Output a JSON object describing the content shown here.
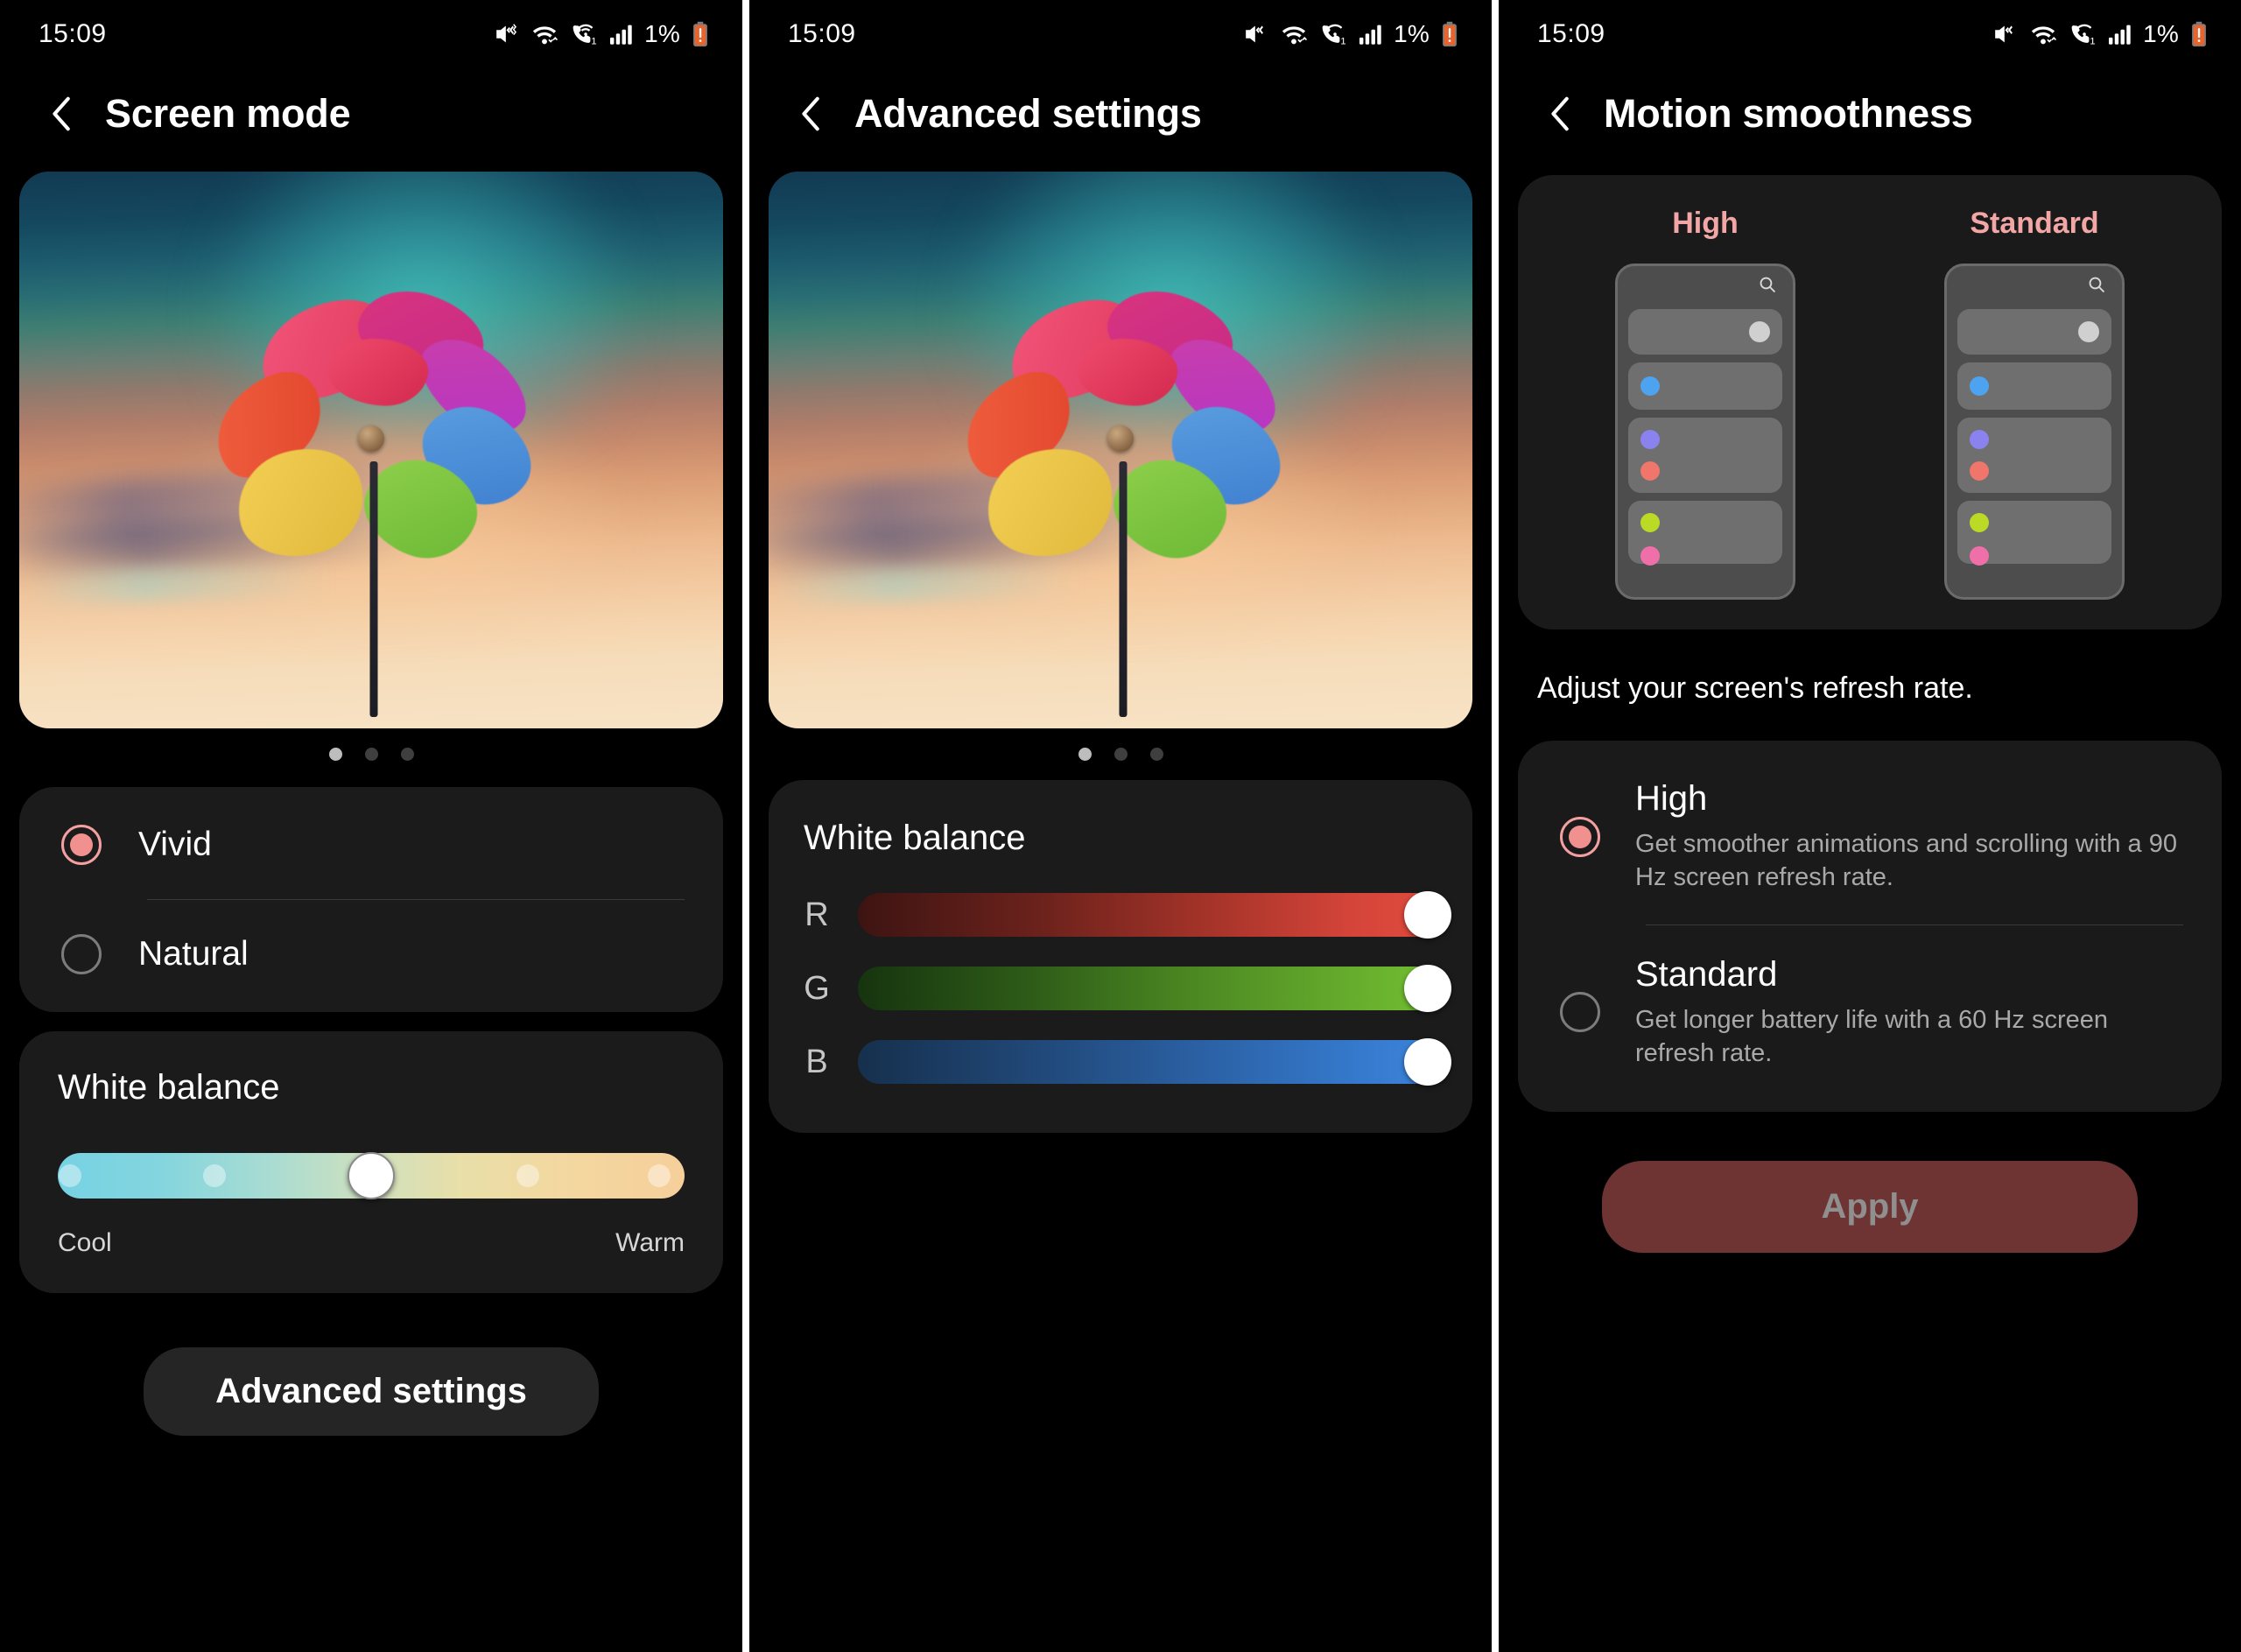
{
  "status_bar": {
    "time": "15:09",
    "battery_percent": "1%",
    "icons": [
      "mute-vibrate-icon",
      "wifi-icon",
      "wifi-calling-icon",
      "signal-bars-icon",
      "battery-low-icon"
    ]
  },
  "colors": {
    "accent_pink": "#f0918f",
    "screen_bg": "#000000",
    "card_bg": "#1b1b1b",
    "apply_disabled_bg": "#6e3434",
    "apply_disabled_text": "#8f8f8f",
    "preview_title": "#f2a6a6"
  },
  "panel1": {
    "title": "Screen mode",
    "back_icon": "chevron-left-icon",
    "pager": {
      "count": 3,
      "active_index": 0
    },
    "modes": [
      {
        "label": "Vivid",
        "selected": true
      },
      {
        "label": "Natural",
        "selected": false
      }
    ],
    "white_balance": {
      "title": "White balance",
      "left_label": "Cool",
      "right_label": "Warm",
      "value_percent": 50,
      "tick_percents": [
        2,
        25,
        50,
        75,
        96
      ]
    },
    "advanced_button": "Advanced settings"
  },
  "panel2": {
    "title": "Advanced settings",
    "back_icon": "chevron-left-icon",
    "pager": {
      "count": 3,
      "active_index": 0
    },
    "white_balance": {
      "title": "White balance",
      "channels": [
        {
          "letter": "R",
          "value_percent": 100
        },
        {
          "letter": "G",
          "value_percent": 100
        },
        {
          "letter": "B",
          "value_percent": 100
        }
      ]
    }
  },
  "panel3": {
    "title": "Motion smoothness",
    "back_icon": "chevron-left-icon",
    "previews": [
      {
        "label": "High",
        "search_icon": "search-icon"
      },
      {
        "label": "Standard",
        "search_icon": "search-icon"
      }
    ],
    "description": "Adjust your screen's refresh rate.",
    "options": [
      {
        "title": "High",
        "subtitle": "Get smoother animations and scrolling with a 90 Hz screen refresh rate.",
        "selected": true
      },
      {
        "title": "Standard",
        "subtitle": "Get longer battery life with a 60 Hz screen refresh rate.",
        "selected": false
      }
    ],
    "apply_button": "Apply",
    "apply_enabled": false
  }
}
